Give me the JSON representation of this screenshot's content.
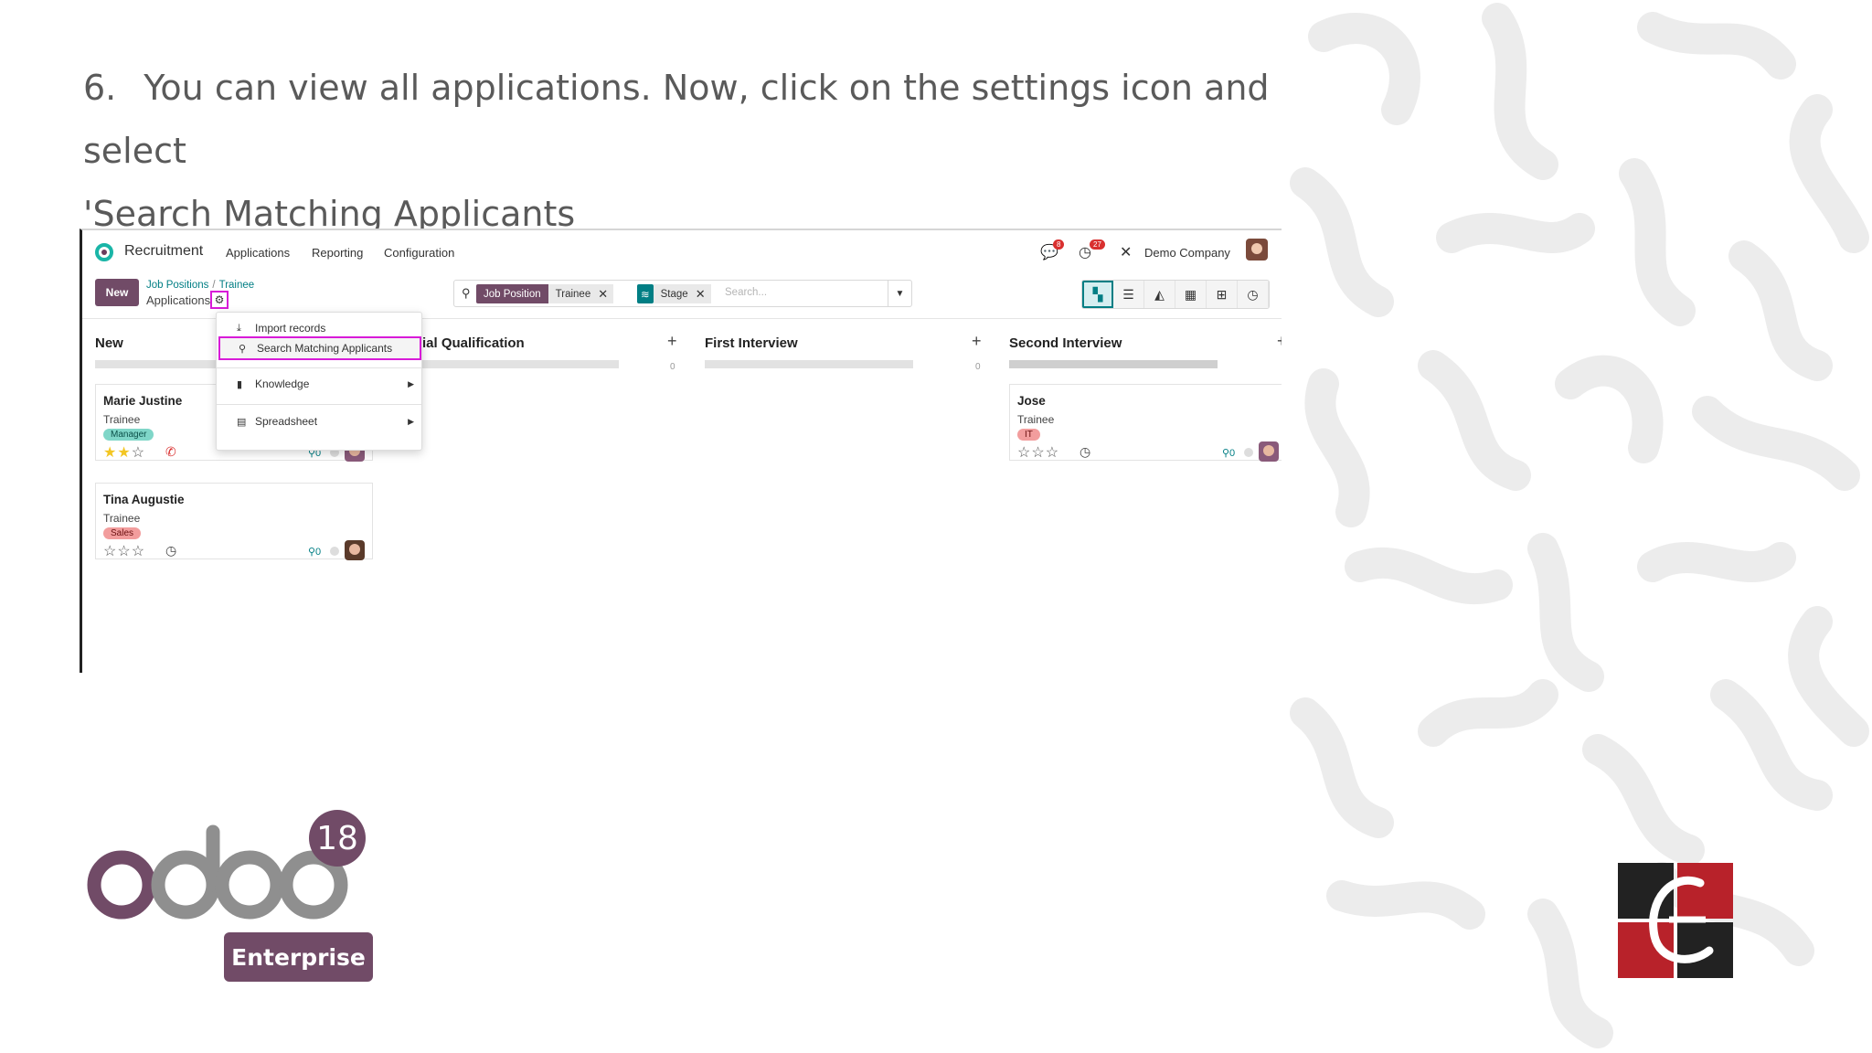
{
  "instruction": {
    "number": "6.",
    "line1": "You can view all applications. Now, click on the settings icon and select",
    "line2": "'Search Matching Applicants"
  },
  "topbar": {
    "app_name": "Recruitment",
    "menus": [
      "Applications",
      "Reporting",
      "Configuration"
    ],
    "messages_count": "8",
    "activities_count": "27",
    "company": "Demo Company"
  },
  "control": {
    "new_label": "New",
    "breadcrumb": [
      "Job Positions",
      "Trainee"
    ],
    "subtitle": "Applications"
  },
  "search": {
    "facets": [
      {
        "label": "Job Position",
        "value": "Trainee",
        "color": "#714b67"
      },
      {
        "label": "Stage",
        "value": "",
        "color": "#017e84"
      }
    ],
    "placeholder": "Search..."
  },
  "views": [
    "kanban-icon",
    "list-icon",
    "graph-icon",
    "calendar-icon",
    "pivot-icon",
    "activity-icon"
  ],
  "columns": [
    {
      "title": "New",
      "count": ""
    },
    {
      "title": "ial Qualification",
      "count": "0"
    },
    {
      "title": "First Interview",
      "count": "0"
    },
    {
      "title": "Second Interview",
      "count": ""
    }
  ],
  "cards": [
    {
      "name": "Marie Justine",
      "job": "Trainee",
      "tag": "Manager",
      "tag_color": "#7fd6c8",
      "stars": 2,
      "attachments": "0"
    },
    {
      "name": "Tina Augustie",
      "job": "Trainee",
      "tag": "Sales",
      "tag_color": "#f29d9d",
      "stars": 0,
      "attachments": "0"
    },
    {
      "name": "Jose",
      "job": "Trainee",
      "tag": "IT",
      "tag_color": "#f29d9d",
      "stars": 0,
      "attachments": "0"
    }
  ],
  "dropdown": {
    "import": "Import records",
    "search_matching": "Search Matching Applicants",
    "knowledge": "Knowledge",
    "spreadsheet": "Spreadsheet"
  },
  "branding": {
    "odoo_word": "odoo",
    "version": "18",
    "edition": "Enterprise",
    "accent": "#714b67"
  }
}
